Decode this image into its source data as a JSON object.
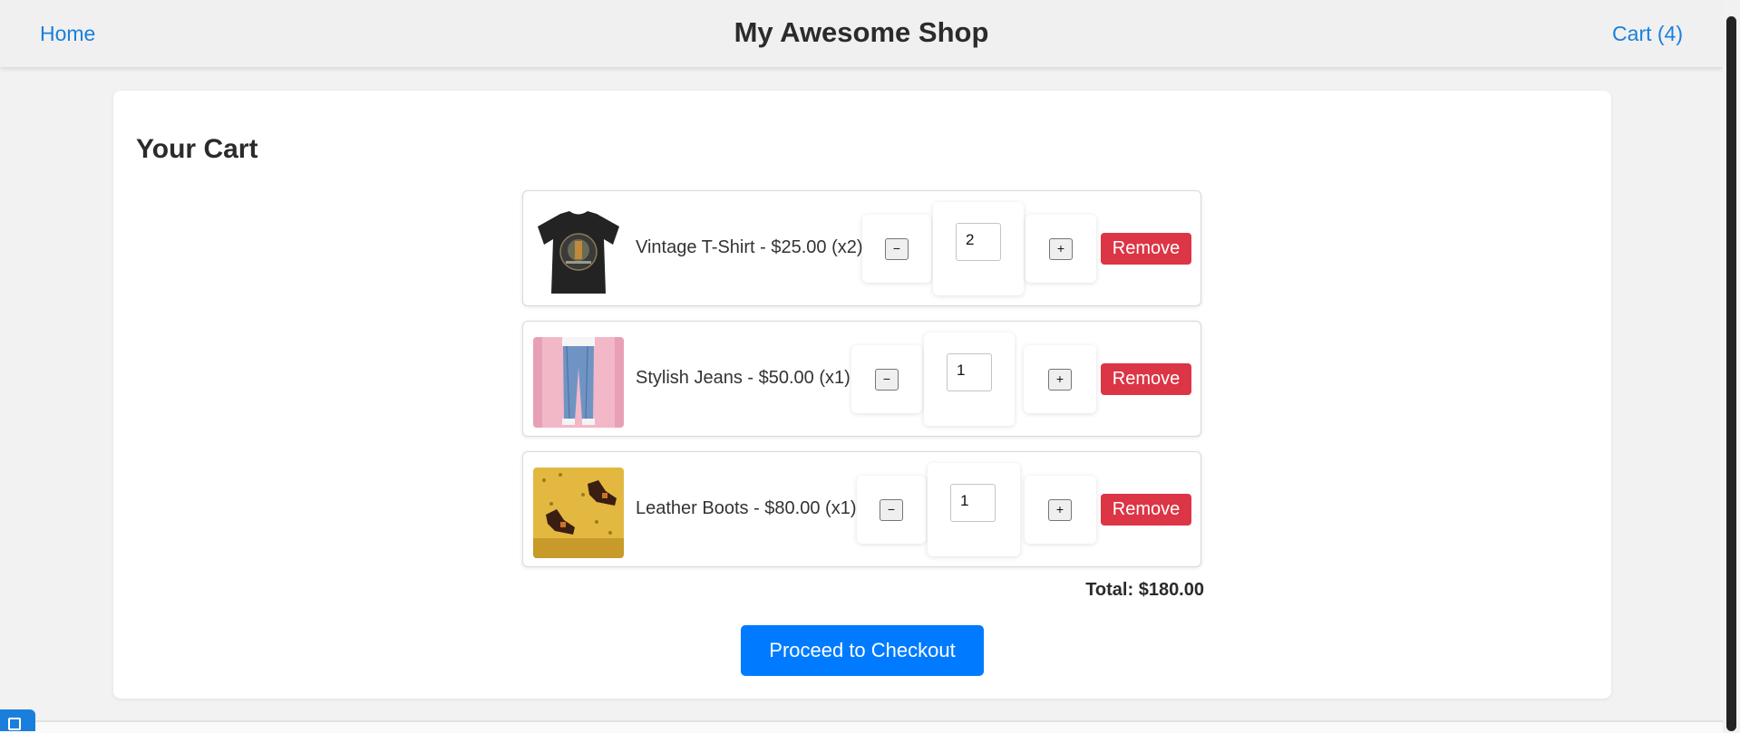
{
  "header": {
    "home_label": "Home",
    "title": "My Awesome Shop",
    "cart_label": "Cart (4)"
  },
  "cart": {
    "heading": "Your Cart",
    "items": [
      {
        "label": "Vintage T-Shirt - $25.00 (x2)",
        "quantity": "2",
        "minus": "−",
        "plus": "+",
        "remove": "Remove",
        "image": "tshirt-photo"
      },
      {
        "label": "Stylish Jeans - $50.00 (x1)",
        "quantity": "1",
        "minus": "−",
        "plus": "+",
        "remove": "Remove",
        "image": "jeans-photo"
      },
      {
        "label": "Leather Boots - $80.00 (x1)",
        "quantity": "1",
        "minus": "−",
        "plus": "+",
        "remove": "Remove",
        "image": "boots-photo"
      }
    ],
    "total": "Total: $180.00",
    "checkout_label": "Proceed to Checkout"
  },
  "colors": {
    "link": "#1a7fdc",
    "remove": "#dc3545",
    "primary": "#007bff",
    "page_bg": "#f2f2f2"
  }
}
